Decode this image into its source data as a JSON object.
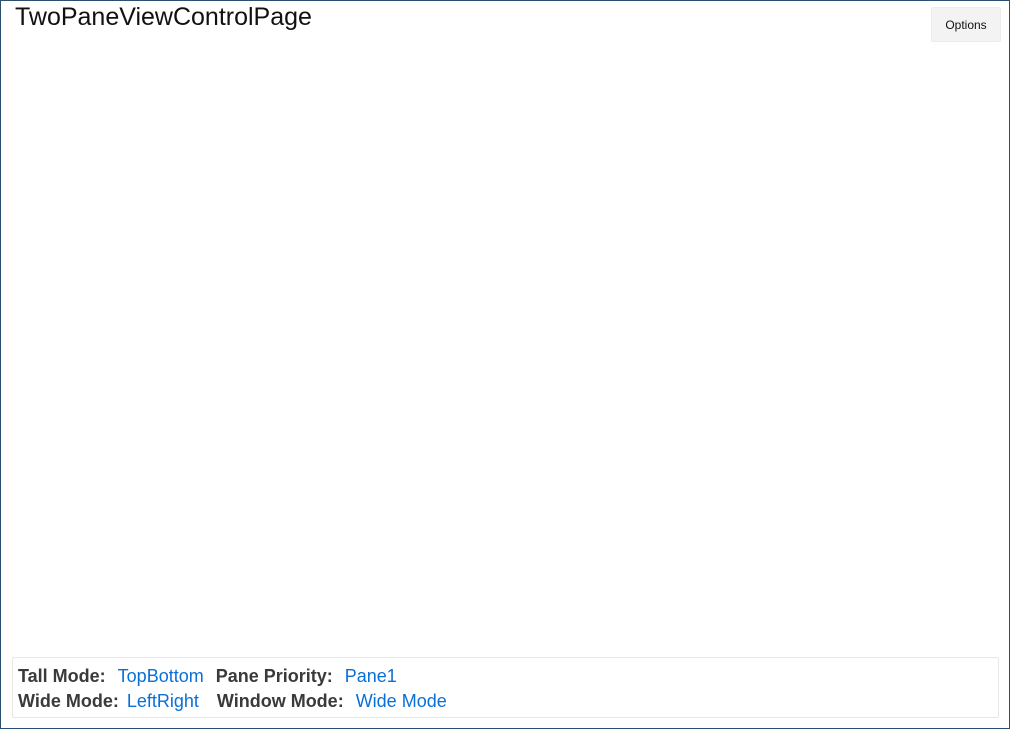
{
  "page": {
    "title": "TwoPaneViewControlPage"
  },
  "toolbar": {
    "options_label": "Options"
  },
  "status": {
    "tall_mode_label": "Tall Mode:",
    "tall_mode_value": "TopBottom",
    "pane_priority_label": "Pane Priority:",
    "pane_priority_value": "Pane1",
    "wide_mode_label": "Wide Mode:",
    "wide_mode_value": "LeftRight",
    "window_mode_label": "Window Mode:",
    "window_mode_value": "Wide Mode"
  },
  "colors": {
    "value_text": "#0a6fd6",
    "label_text": "#3a3a3a",
    "window_border": "#2b4f6e"
  }
}
